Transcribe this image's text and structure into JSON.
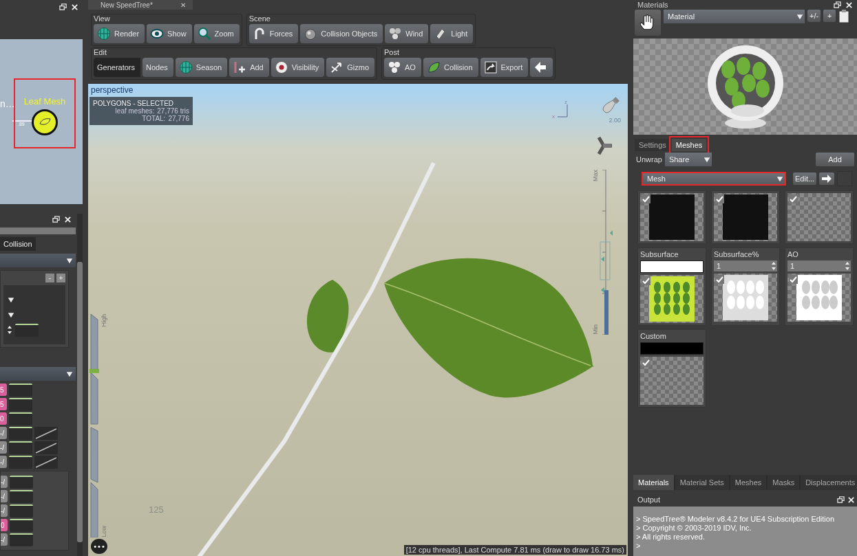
{
  "graph": {
    "cut_label": "n…",
    "edge_label": ".89",
    "node": {
      "label": "Leaf Mesh",
      "highlighted": true
    }
  },
  "left_panel": {
    "tab": "Collision",
    "minus": "-",
    "plus": "+",
    "group_rows": [
      {
        "button": "5",
        "color": "#d9609a",
        "curve": false
      },
      {
        "button": "5",
        "color": "#d9609a",
        "curve": false
      },
      {
        "button": "0",
        "color": "#d9609a",
        "curve": false
      },
      {
        "button": "/-",
        "color": "#8c8c8c",
        "curve": true
      },
      {
        "button": "/-",
        "color": "#8c8c8c",
        "curve": true
      },
      {
        "button": "/-",
        "color": "#8c8c8c",
        "curve": true
      }
    ],
    "box_rows": [
      {
        "button": "/-",
        "color": "#8c8c8c"
      },
      {
        "button": "/-",
        "color": "#8c8c8c"
      },
      {
        "button": "/-",
        "color": "#8c8c8c"
      },
      {
        "button": "0",
        "color": "#d9609a"
      },
      {
        "button": "/-",
        "color": "#8c8c8c"
      }
    ]
  },
  "document_tab": {
    "title": "New SpeedTree*",
    "close": "✕"
  },
  "toolbar": {
    "rows": [
      [
        {
          "title": "View",
          "buttons": [
            {
              "label": "Render",
              "selected": false
            },
            {
              "label": "Show",
              "selected": false
            },
            {
              "label": "Zoom",
              "selected": false
            }
          ]
        },
        {
          "title": "Scene",
          "buttons": [
            {
              "label": "Forces",
              "selected": false
            },
            {
              "label": "Collision Objects",
              "selected": false
            },
            {
              "label": "Wind",
              "selected": false
            },
            {
              "label": "Light",
              "selected": false
            }
          ]
        }
      ],
      [
        {
          "title": "Edit",
          "buttons": [
            {
              "label": "Generators",
              "selected": true
            },
            {
              "label": "Nodes",
              "selected": false
            },
            {
              "label": "Season",
              "selected": false
            },
            {
              "label": "Add",
              "selected": false
            },
            {
              "label": "Visibility",
              "selected": false
            },
            {
              "label": "Gizmo",
              "selected": false
            }
          ]
        },
        {
          "title": "Post",
          "buttons": [
            {
              "label": "AO",
              "selected": false
            },
            {
              "label": "Collision",
              "selected": false
            },
            {
              "label": "Export",
              "selected": false
            },
            {
              "selected": false
            }
          ]
        }
      ]
    ]
  },
  "viewport": {
    "view_name": "perspective",
    "stats": {
      "title": "POLYGONS - SELECTED",
      "rows": [
        {
          "label": "leaf meshes:",
          "value": "27,776 tris"
        },
        {
          "label": "TOTAL:",
          "value": "27,776"
        }
      ]
    },
    "axis": {
      "up": "z",
      "side": "x"
    },
    "light_value": "2.00",
    "lod_slider": {
      "top": "Max",
      "bottom": "Min",
      "level": 0.27
    },
    "season_slider": {
      "top": "High",
      "bottom": "Low",
      "level": 0.75
    },
    "frame_number": "125",
    "more": "•••",
    "status": "[12 cpu threads], Last Compute 7.81 ms (draw to draw 16.73 ms)"
  },
  "materials": {
    "title": "Materials",
    "material": "Material",
    "plus_minus": "+/-",
    "add": "+",
    "tabs": [
      {
        "label": "Settings",
        "selected": false,
        "highlighted": false
      },
      {
        "label": "Meshes",
        "selected": true,
        "highlighted": true
      }
    ],
    "unwrap_label": "Unwrap",
    "unwrap_value": "Share",
    "add_button": "Add",
    "mesh": {
      "value": "Mesh",
      "highlighted": true
    },
    "edit_button": "Edit...",
    "textures": [
      {
        "kind": "plain",
        "checked": true
      },
      {
        "kind": "plain",
        "checked": true
      },
      {
        "kind": "plain",
        "checked": true
      },
      {
        "kind": "color",
        "label": "Subsurface",
        "color": "#ffffff",
        "checked": true
      },
      {
        "kind": "number",
        "label": "Subsurface%",
        "value": "1",
        "checked": true
      },
      {
        "kind": "number",
        "label": "AO",
        "value": "1",
        "checked": true
      },
      {
        "kind": "color",
        "label": "Custom",
        "color": "#000000",
        "checked": true
      }
    ],
    "bottom_tabs": [
      {
        "label": "Materials",
        "selected": true
      },
      {
        "label": "Material Sets",
        "selected": false
      },
      {
        "label": "Meshes",
        "selected": false
      },
      {
        "label": "Masks",
        "selected": false
      },
      {
        "label": "Displacements",
        "selected": false
      }
    ]
  },
  "output": {
    "title": "Output",
    "lines": [
      "> SpeedTree® Modeler v8.4.2 for UE4 Subscription Edition",
      "> Copyright © 2003-2019 IDV, Inc.",
      "> All rights reserved.",
      ">"
    ]
  }
}
